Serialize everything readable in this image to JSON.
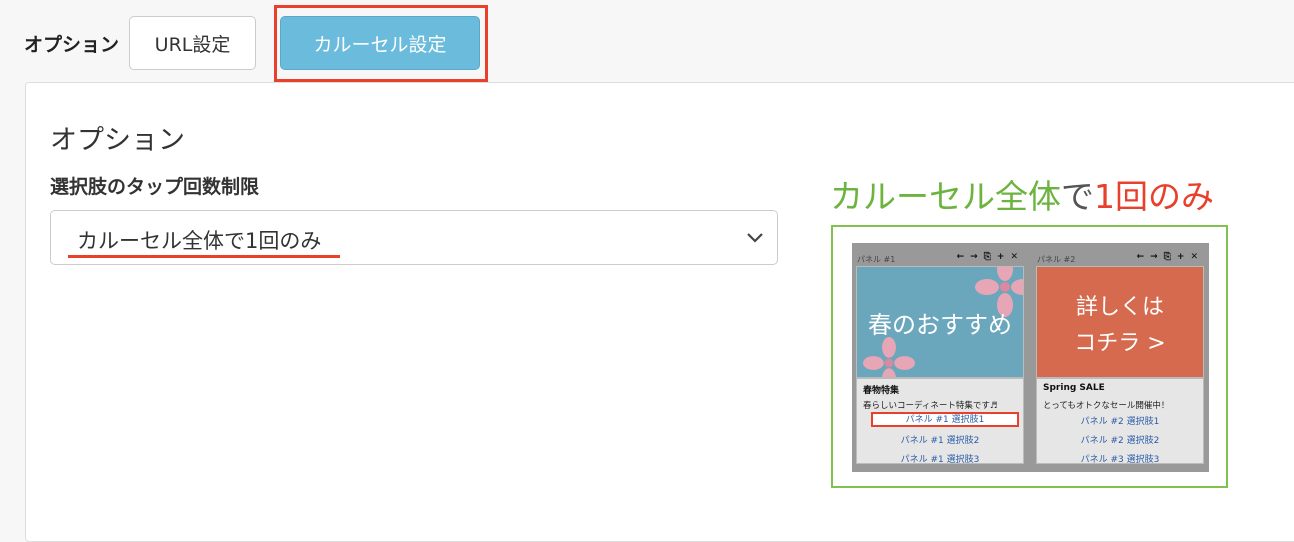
{
  "tabs": {
    "group_label": "オプション",
    "url_tab": "URL設定",
    "carousel_tab": "カルーセル設定"
  },
  "panel": {
    "section_title": "オプション",
    "field_label": "選択肢のタップ回数制限",
    "select_value": "カルーセル全体で1回のみ",
    "chevron_icon": "chevron-down-icon"
  },
  "illustration": {
    "caption_part1": "カルーセル全体",
    "caption_part2": "で",
    "caption_part3": "1回のみ",
    "colors": {
      "caption_green": "#6db33f",
      "caption_red": "#e8402a",
      "frame": "#82c050"
    },
    "tool_icons": [
      "arrow-left-icon",
      "arrow-right-icon",
      "copy-icon",
      "plus-icon",
      "close-icon"
    ],
    "cards": [
      {
        "label": "パネル #1",
        "tools": "←→⎘+✕",
        "image_text": "春のおすすめ",
        "title": "春物特集",
        "description": "春らしいコーディネート特集です♬",
        "choices": [
          "パネル #1 選択肢1",
          "パネル #1 選択肢2",
          "パネル #1 選択肢3"
        ]
      },
      {
        "label": "パネル #2",
        "tools": "←→⎘+✕",
        "image_text_line1": "詳しくは",
        "image_text_line2": "コチラ >",
        "title": "Spring SALE",
        "description": "とってもオトクなセール開催中！",
        "choices": [
          "パネル #2 選択肢1",
          "パネル #2 選択肢2",
          "パネル #3 選択肢3"
        ]
      }
    ]
  }
}
